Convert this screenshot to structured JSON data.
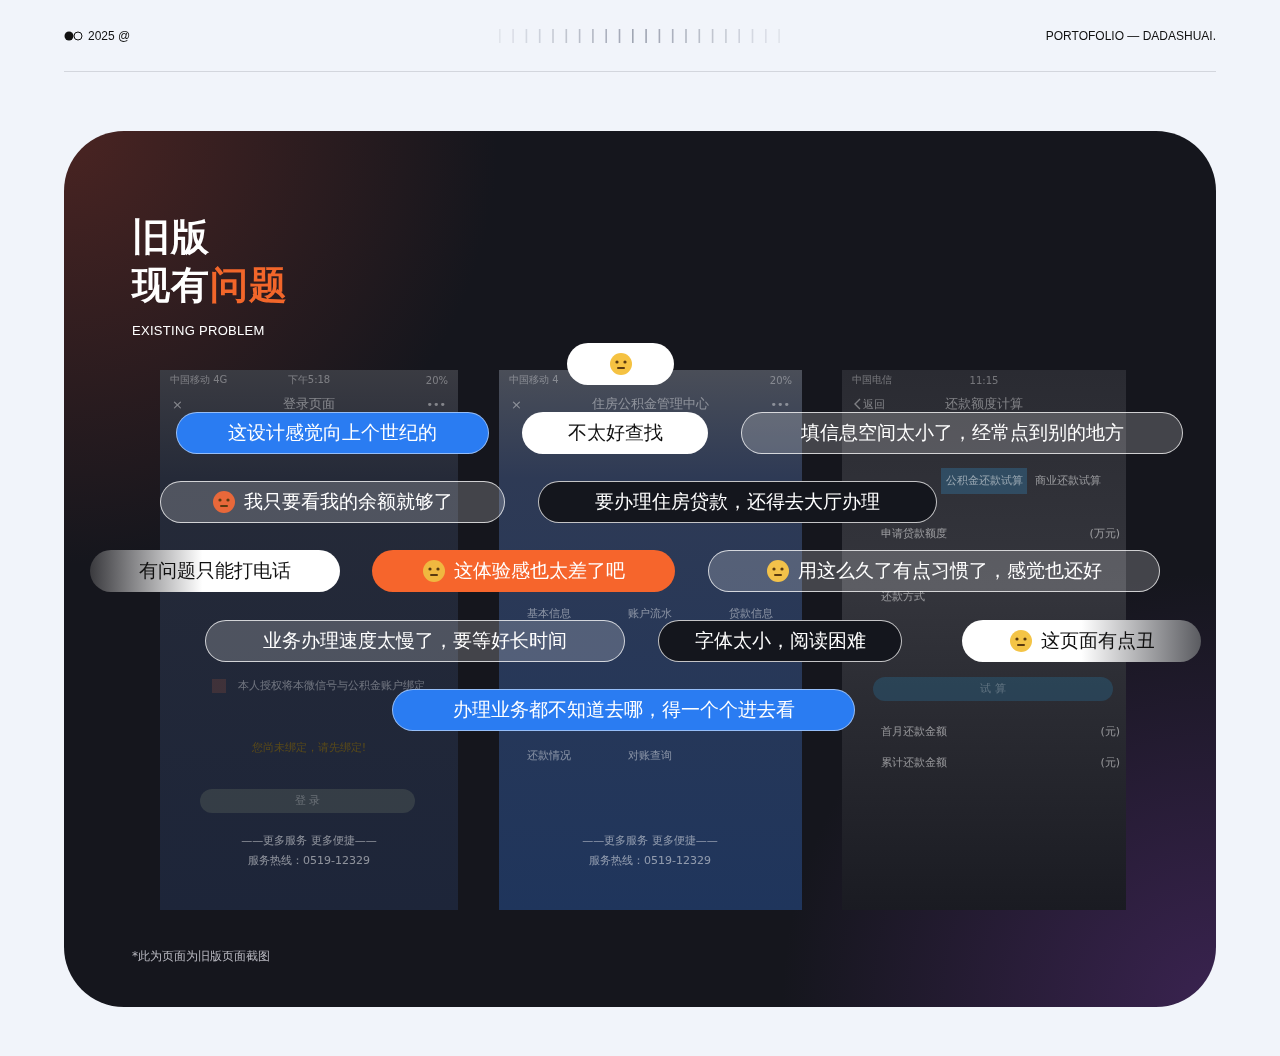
{
  "header": {
    "year_label": "2025 @",
    "brand": "PORTOFOLIO — DADASHUAI."
  },
  "heading": {
    "line1": "旧版",
    "line2_plain": "现有",
    "line2_accent": "问题",
    "subtitle": "EXISTING PROBLEM"
  },
  "phones": [
    {
      "status": {
        "carrier": "中国移动  4G",
        "time": "下午5:18",
        "battery": "20%"
      },
      "nav": {
        "title": "登录页面",
        "close": "×",
        "more": "•••"
      },
      "items": [
        {
          "kind": "checkbox",
          "text": "本人授权将本微信号与公积金账户绑定",
          "checked": false
        },
        {
          "kind": "warning",
          "text": "您尚未绑定，请先绑定!"
        },
        {
          "kind": "button",
          "text": "登 录"
        },
        {
          "kind": "footer",
          "text": "——更多服务 更多便捷——"
        },
        {
          "kind": "footer",
          "text": "服务热线：0519-12329"
        }
      ]
    },
    {
      "status": {
        "carrier": "中国移动 4",
        "battery": "20%"
      },
      "nav": {
        "title": "住房公积金管理中心",
        "close": "×",
        "more": "•••"
      },
      "items": [
        {
          "kind": "menu",
          "text": "基本信息"
        },
        {
          "kind": "menu",
          "text": "账户流水"
        },
        {
          "kind": "menu",
          "text": "贷款信息"
        },
        {
          "kind": "menu",
          "text": "还款情况"
        },
        {
          "kind": "menu",
          "text": "对账查询"
        },
        {
          "kind": "footer",
          "text": "——更多服务 更多便捷——"
        },
        {
          "kind": "footer",
          "text": "服务热线：0519-12329"
        }
      ]
    },
    {
      "status": {
        "carrier": "中国电信",
        "time": "11:15"
      },
      "nav": {
        "title": "还款额度计算",
        "back": "返回"
      },
      "items": [
        {
          "kind": "tab",
          "text": "公积金还款试算",
          "selected": true
        },
        {
          "kind": "tab",
          "text": "商业还款试算",
          "selected": false
        },
        {
          "kind": "label",
          "text": "申请贷款额度"
        },
        {
          "kind": "unit",
          "text": "(万元)"
        },
        {
          "kind": "label",
          "text": "还款方式"
        },
        {
          "kind": "button",
          "text": "试 算"
        },
        {
          "kind": "label",
          "text": "首月还款金额"
        },
        {
          "kind": "unit",
          "text": "(元)"
        },
        {
          "kind": "label",
          "text": "累计还款金额"
        },
        {
          "kind": "unit",
          "text": "(元)"
        }
      ]
    }
  ],
  "bubbles": [
    {
      "kind": "plain"
    },
    {
      "kind": "highlight",
      "text": "这设计感觉向上个世纪的"
    },
    {
      "kind": "plain",
      "text": "不太好查找"
    },
    {
      "kind": "outline",
      "text": "填信息空间太小了，经常点到别的地方"
    },
    {
      "kind": "outline",
      "text": "我只要看我的余额就够了"
    },
    {
      "kind": "solid",
      "text": "要办理住房贷款，还得去大厅办理"
    },
    {
      "kind": "fade-left",
      "text": "有问题只能打电话"
    },
    {
      "kind": "accent",
      "text": "这体验感也太差了吧"
    },
    {
      "kind": "outline",
      "text": "用这么久了有点习惯了，感觉也还好"
    },
    {
      "kind": "outline",
      "text": "业务办理速度太慢了，要等好长时间"
    },
    {
      "kind": "solid",
      "text": "字体太小，阅读困难"
    },
    {
      "kind": "fade-right",
      "text": "这页面有点丑"
    },
    {
      "kind": "highlight",
      "text": "办理业务都不知道去哪，得一个个进去看"
    }
  ],
  "footnote": "*此为页面为旧版页面截图"
}
